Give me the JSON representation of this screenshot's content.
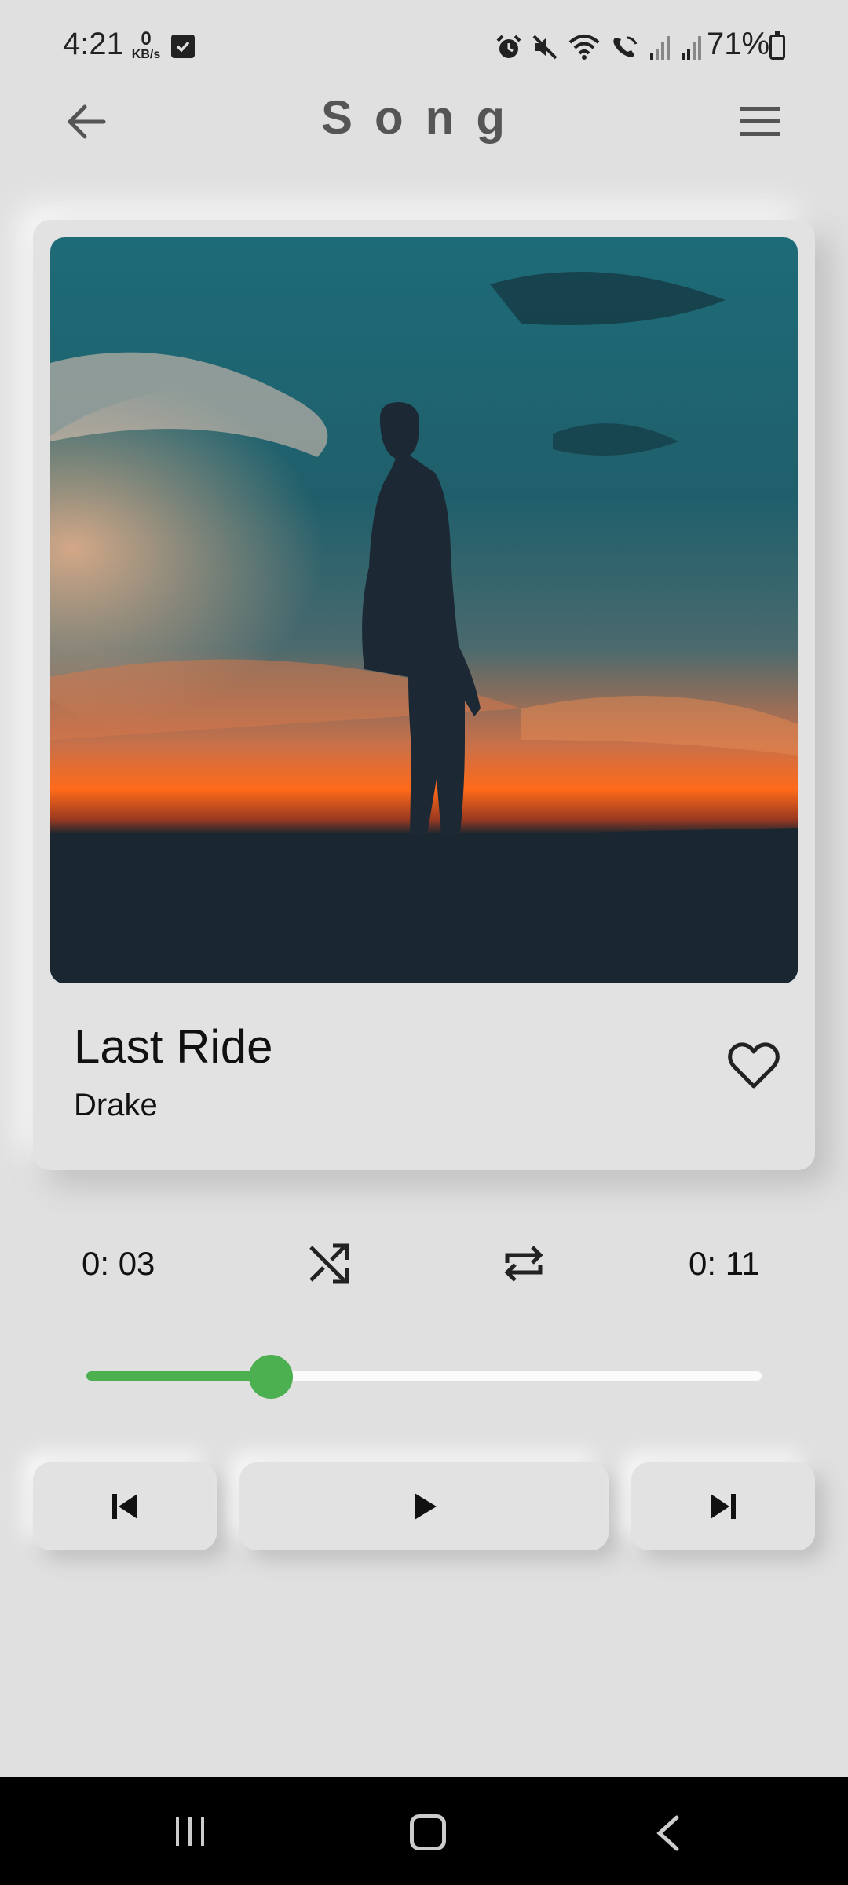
{
  "status_bar": {
    "time": "4:21",
    "net_speed_value": "0",
    "net_speed_unit": "KB/s",
    "battery": "71%",
    "icons": [
      "alarm-icon",
      "mute-icon",
      "wifi-icon",
      "wifi-call-icon",
      "signal-icon",
      "signal-icon"
    ]
  },
  "header": {
    "title": "Song",
    "back_icon": "arrow-left-icon",
    "menu_icon": "hamburger-menu-icon"
  },
  "song": {
    "title": "Last Ride",
    "artist": "Drake",
    "favorite_icon": "heart-outline-icon"
  },
  "player": {
    "current_time": "0: 03",
    "total_time": "0: 11",
    "progress_fraction": 0.273,
    "shuffle_icon": "shuffle-icon",
    "repeat_icon": "repeat-icon",
    "prev_icon": "skip-previous-icon",
    "play_icon": "play-icon",
    "next_icon": "skip-next-icon"
  },
  "colors": {
    "background": "#e0e0e0",
    "accent": "#4caf50",
    "track": "#fbfbfb",
    "title_text": "#555555"
  },
  "nav_bar": {
    "icons": [
      "recents-icon",
      "home-icon",
      "back-icon"
    ]
  }
}
